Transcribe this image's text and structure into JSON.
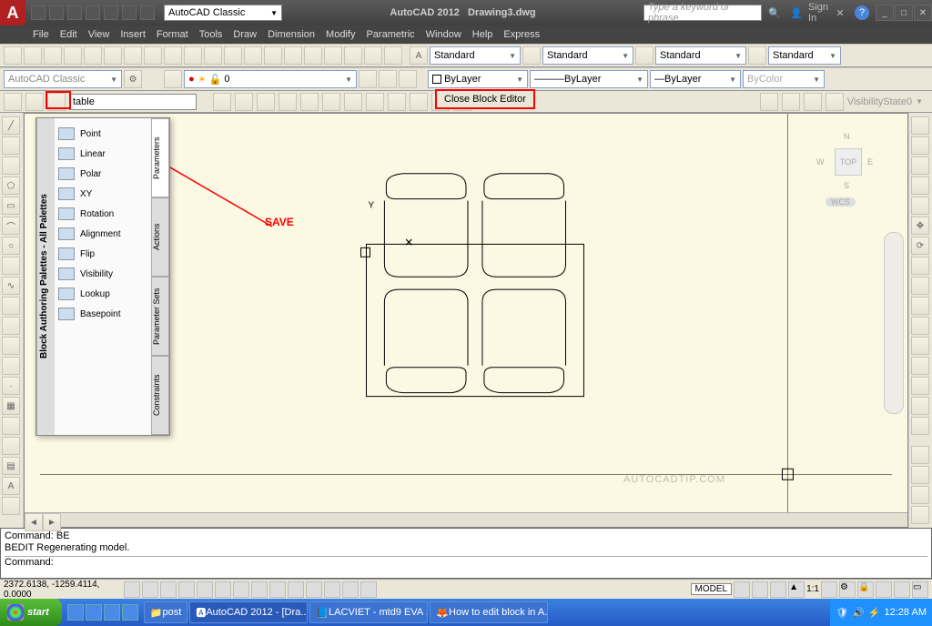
{
  "title": {
    "app": "AutoCAD 2012",
    "doc": "Drawing3.dwg"
  },
  "workspace_selector": "AutoCAD Classic",
  "search_placeholder": "Type a keyword or phrase",
  "signin": "Sign In",
  "menu": [
    "File",
    "Edit",
    "View",
    "Insert",
    "Format",
    "Tools",
    "Draw",
    "Dimension",
    "Modify",
    "Parametric",
    "Window",
    "Help",
    "Express"
  ],
  "toolbar2": {
    "workspace_dd": "AutoCAD Classic",
    "layer_dd": "0",
    "bylayer": "ByLayer",
    "bycolor": "ByColor",
    "std": "Standard"
  },
  "blockedit": {
    "blockname": "table",
    "close_label": "Close Block Editor",
    "visibility": "VisibilityState0"
  },
  "palette": {
    "title": "Block Authoring Palettes - All Palettes",
    "tabs": [
      "Parameters",
      "Actions",
      "Parameter Sets",
      "Constraints"
    ],
    "items": [
      "Point",
      "Linear",
      "Polar",
      "XY",
      "Rotation",
      "Alignment",
      "Flip",
      "Visibility",
      "Lookup",
      "Basepoint"
    ]
  },
  "annotation": {
    "save": "SAVE"
  },
  "viewcube": {
    "face": "TOP",
    "n": "N",
    "s": "S",
    "e": "E",
    "w": "W",
    "wcs": "WCS"
  },
  "watermark": "AUTOCADTIP.COM",
  "command": {
    "line1": "Command: BE",
    "line2": "BEDIT Regenerating model.",
    "prompt": "Command:"
  },
  "status": {
    "coords": "2372.6138, -1259.4114, 0.0000",
    "modeltab": "MODEL",
    "scale": "1:1"
  },
  "taskbar": {
    "start": "start",
    "tasks": [
      {
        "label": "post",
        "active": false
      },
      {
        "label": "AutoCAD 2012 - [Dra...",
        "active": true
      },
      {
        "label": "LACVIET - mtd9 EVA ...",
        "active": false
      },
      {
        "label": "How to edit block in A...",
        "active": false
      }
    ],
    "clock": "12:28 AM"
  }
}
